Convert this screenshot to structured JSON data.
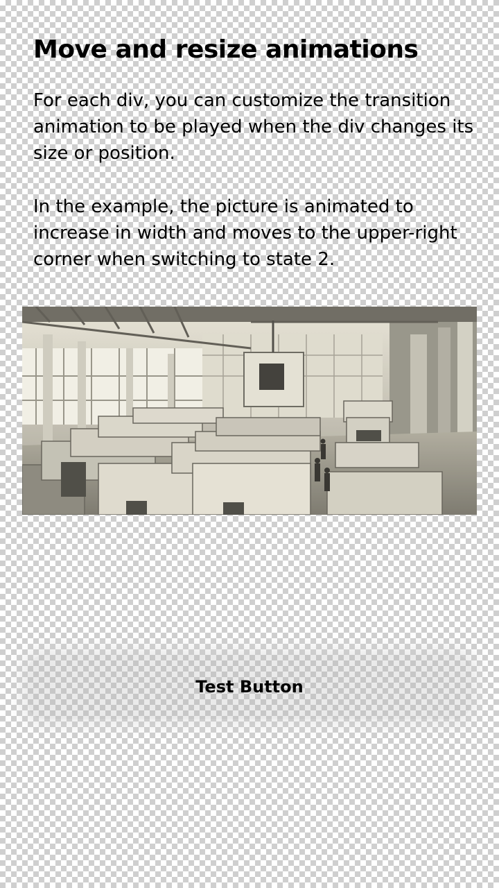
{
  "title": "Move and resize animations",
  "paragraphs": [
    "For each div, you can customize the transition animation to be played when the div changes its size or position.",
    "In the example, the picture is animated to increase in width and moves to the upper-right corner when switching to state 2."
  ],
  "image": {
    "subject": "black-and-white photo of a factory hall with rows of prefabricated modular cabins"
  },
  "button": {
    "label": "Test Button"
  },
  "colors": {
    "text": "#000000",
    "checker_light": "#ffffff",
    "checker_dark": "#cfcfcf"
  }
}
